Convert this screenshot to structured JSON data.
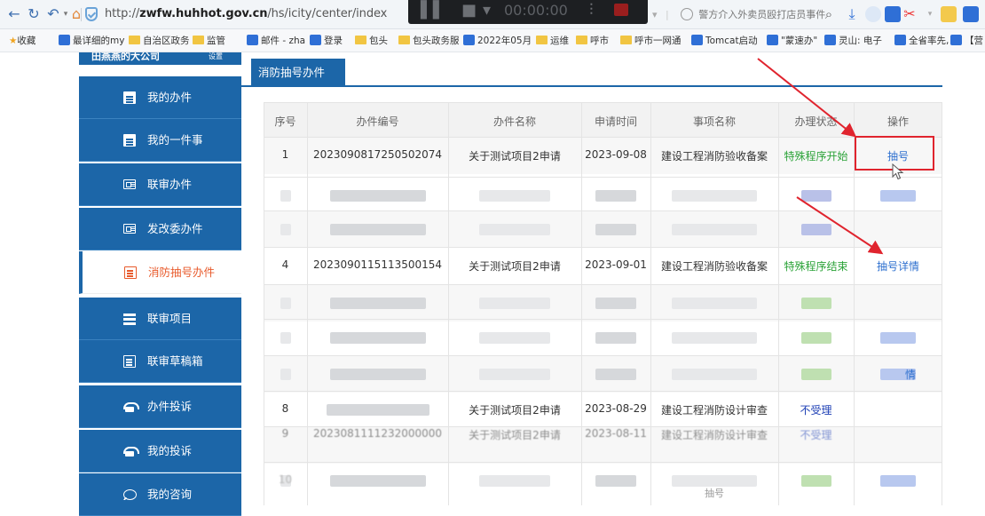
{
  "browser": {
    "url_prefix": "http://",
    "url_host": "zwfw.huhhot.gov.cn",
    "url_path": "/hs/icity/center/index",
    "overlay_time": "00:00:00",
    "search_suggestion": "警方介入外卖员殴打店员事件"
  },
  "bookmarks": [
    {
      "label": "收藏",
      "icon": "star-icon"
    },
    {
      "label": "最详细的my",
      "icon": "bookmark-icon"
    },
    {
      "label": "自治区政务",
      "icon": "folder-icon"
    },
    {
      "label": "监管",
      "icon": "folder-icon"
    },
    {
      "label": "邮件 - zha",
      "icon": "mail-icon"
    },
    {
      "label": "登录",
      "icon": "bookmark-icon"
    },
    {
      "label": "包头",
      "icon": "folder-icon"
    },
    {
      "label": "包头政务服",
      "icon": "folder-icon"
    },
    {
      "label": "2022年05月",
      "icon": "bookmark-icon"
    },
    {
      "label": "运维",
      "icon": "folder-icon"
    },
    {
      "label": "呼市",
      "icon": "folder-icon"
    },
    {
      "label": "呼市一网通",
      "icon": "folder-icon"
    },
    {
      "label": "Tomcat启动",
      "icon": "bookmark-icon"
    },
    {
      "label": "\"蒙速办\"",
      "icon": "bookmark-icon"
    },
    {
      "label": "灵山: 电子",
      "icon": "bookmark-icon"
    },
    {
      "label": "全省率先,",
      "icon": "bookmark-icon"
    },
    {
      "label": "【营",
      "icon": "bookmark-icon"
    }
  ],
  "sidebar": {
    "org_name": "田燕燕的大公司",
    "org_action": "设置",
    "items": [
      {
        "label": "我的办件",
        "icon": "document-icon",
        "active": false
      },
      {
        "label": "我的一件事",
        "icon": "document-icon",
        "active": false
      },
      {
        "label": "联审办件",
        "icon": "card-icon",
        "active": false
      },
      {
        "label": "发改委办件",
        "icon": "card-icon",
        "active": false
      },
      {
        "label": "消防抽号办件",
        "icon": "document-icon",
        "active": true
      },
      {
        "label": "联审项目",
        "icon": "list-icon",
        "active": false
      },
      {
        "label": "联审草稿箱",
        "icon": "document-icon",
        "active": false
      },
      {
        "label": "办件投诉",
        "icon": "phone-icon",
        "active": false
      },
      {
        "label": "我的投诉",
        "icon": "phone-icon",
        "active": false
      },
      {
        "label": "我的咨询",
        "icon": "chat-icon",
        "active": false
      }
    ]
  },
  "main": {
    "tab_label": "消防抽号办件",
    "columns": [
      "序号",
      "办件编号",
      "办件名称",
      "申请时间",
      "事项名称",
      "办理状态",
      "操作"
    ],
    "rows": [
      {
        "no": "1",
        "code": "2023090817250502074",
        "name": "关于测试项目2申请",
        "date": "2023-09-08",
        "item": "建设工程消防验收备案",
        "status": "特殊程序开始",
        "action": "抽号",
        "blurred": false
      },
      {
        "blurred": true
      },
      {
        "blurred": true
      },
      {
        "no": "4",
        "code": "2023090115113500154",
        "name": "关于测试项目2申请",
        "date": "2023-09-01",
        "item": "建设工程消防验收备案",
        "status": "特殊程序结束",
        "action": "抽号详情",
        "blurred": false
      },
      {
        "blurred": true
      },
      {
        "blurred": true
      },
      {
        "blurred": true,
        "action_fragment": "情"
      },
      {
        "no": "8",
        "name": "关于测试项目2申请",
        "date": "2023-08-29",
        "item": "建设工程消防设计审查",
        "status": "不受理",
        "blurred": false
      },
      {
        "no": "9",
        "code": "2023081111232000000",
        "name": "关于测试项目2申请",
        "date": "2023-08-11",
        "item": "建设工程消防设计审查",
        "status": "不受理",
        "blurred": false,
        "partial": true
      },
      {
        "no": "10",
        "item_fragment": "抽号",
        "blurred": true
      }
    ]
  },
  "colors": {
    "primary": "#1c66a8",
    "active_text": "#e85a2b",
    "status_green": "#2ca339",
    "link_blue": "#2d6fcf",
    "annotation_red": "#e0242e"
  }
}
